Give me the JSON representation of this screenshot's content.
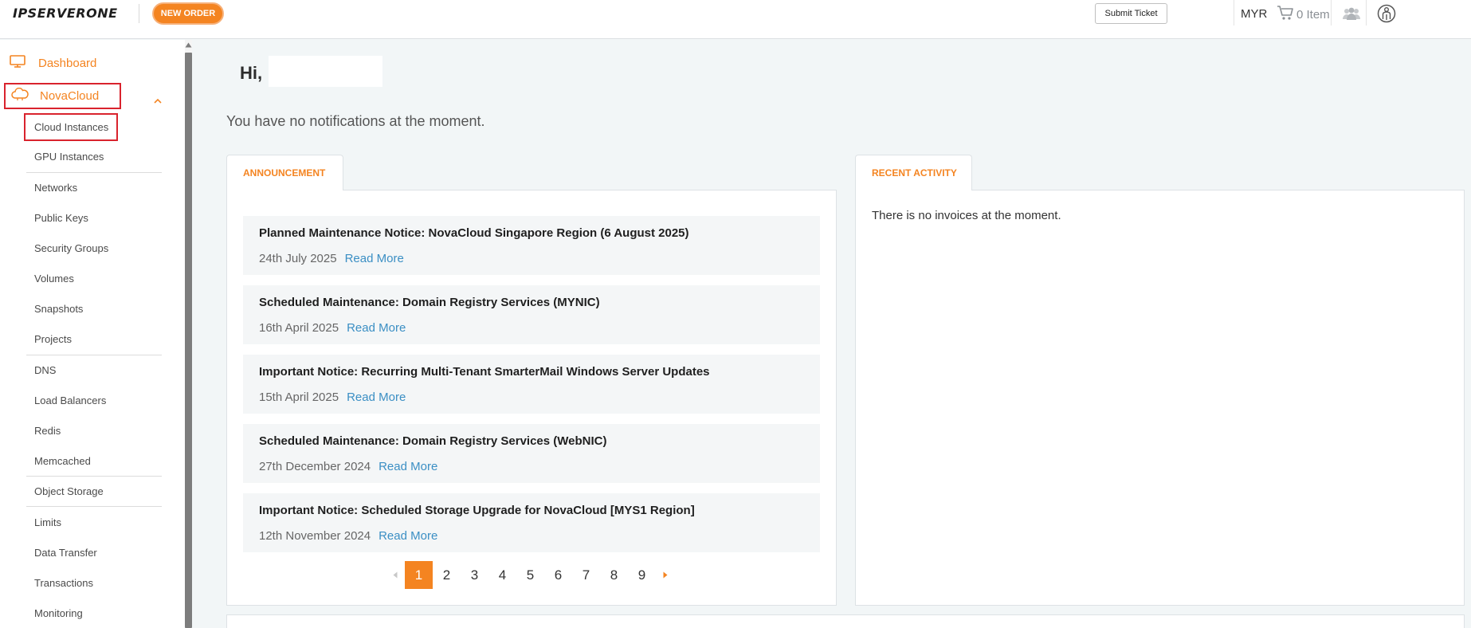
{
  "header": {
    "logo_text": "IPSERVERONE",
    "new_order_label": "NEW ORDER",
    "submit_ticket_label": "Submit Ticket",
    "currency": "MYR",
    "cart_label": "0 Item",
    "icons": [
      "cart-icon",
      "team-icon",
      "account-icon"
    ]
  },
  "sidebar": {
    "dashboard_label": "Dashboard",
    "novacloud_label": "NovaCloud",
    "items": [
      {
        "label": "Cloud Instances"
      },
      {
        "label": "GPU Instances"
      },
      {
        "label": "Networks"
      },
      {
        "label": "Public Keys"
      },
      {
        "label": "Security Groups"
      },
      {
        "label": "Volumes"
      },
      {
        "label": "Snapshots"
      },
      {
        "label": "Projects"
      },
      {
        "label": "DNS"
      },
      {
        "label": "Load Balancers"
      },
      {
        "label": "Redis"
      },
      {
        "label": "Memcached"
      },
      {
        "label": "Object Storage"
      },
      {
        "label": "Limits"
      },
      {
        "label": "Data Transfer"
      },
      {
        "label": "Transactions"
      },
      {
        "label": "Monitoring"
      }
    ]
  },
  "main": {
    "greeting": "Hi,",
    "notification_text": "You have no notifications at the moment.",
    "announcement_tab": "ANNOUNCEMENT",
    "announcements": [
      {
        "title": "Planned Maintenance Notice: NovaCloud Singapore Region (6 August 2025)",
        "date": "24th July 2025",
        "link": "Read More"
      },
      {
        "title": "Scheduled Maintenance: Domain Registry Services (MYNIC)",
        "date": "16th April 2025",
        "link": "Read More"
      },
      {
        "title": "Important Notice: Recurring Multi-Tenant SmarterMail Windows Server Updates",
        "date": "15th April 2025",
        "link": "Read More"
      },
      {
        "title": "Scheduled Maintenance: Domain Registry Services (WebNIC)",
        "date": "27th December 2024",
        "link": "Read More"
      },
      {
        "title": "Important Notice: Scheduled Storage Upgrade for NovaCloud [MYS1 Region]",
        "date": "12th November 2024",
        "link": "Read More"
      }
    ],
    "pagination": {
      "pages": [
        "1",
        "2",
        "3",
        "4",
        "5",
        "6",
        "7",
        "8",
        "9"
      ],
      "current": "1"
    },
    "activity_tab": "RECENT ACTIVITY",
    "activity_empty": "There is no invoices at the moment."
  },
  "colors": {
    "accent": "#f48421",
    "highlight_border": "#d9232d",
    "link": "#3b8fc4",
    "background": "#f2f6f7"
  }
}
